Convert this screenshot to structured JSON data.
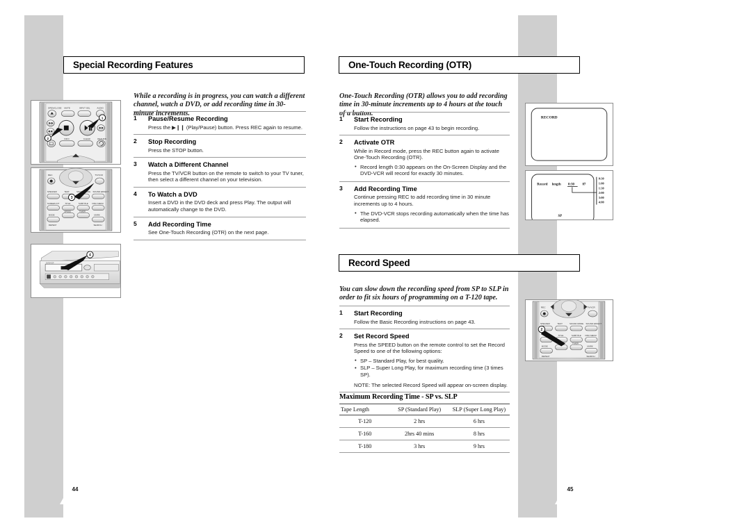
{
  "document": {
    "left_page_number": "44",
    "right_page_number": "45"
  },
  "sections": {
    "special_recording": {
      "title": "Special Recording Features",
      "intro": "While a recording is in progress, you can watch a different channel, watch a DVD, or add recording time in 30-minute increments.",
      "steps": [
        {
          "num": "1",
          "head": "Pause/Resume Recording",
          "text": "Press the ▶❙❙ (Play/Pause) button. Press REC again to resume."
        },
        {
          "num": "2",
          "head": "Stop Recording",
          "text": "Press the STOP button."
        },
        {
          "num": "3",
          "head": "Watch a Different Channel",
          "text": "Press the TV/VCR button on the remote to switch to your TV tuner, then select a different channel on your television."
        },
        {
          "num": "4",
          "head": "To Watch a DVD",
          "text": "Insert a DVD in the DVD deck and press Play. The output will automatically change to the DVD."
        },
        {
          "num": "5",
          "head": "Add Recording Time",
          "text": "See One-Touch Recording (OTR) on the next page."
        }
      ]
    },
    "one_touch_recording": {
      "title": "One-Touch Recording (OTR)",
      "intro": "One-Touch Recording (OTR) allows you to add recording time in 30-minute increments up to 4 hours at the touch of a button.",
      "steps": [
        {
          "num": "1",
          "head": "Start Recording",
          "text": "Follow the instructions on page 43 to begin recording."
        },
        {
          "num": "2",
          "head": "Activate OTR",
          "text": "While in Record mode, press the REC button again to activate One-Touch Recording (OTR).",
          "bullets": [
            "Record length 0:30 appears on the On-Screen Display and the DVD-VCR will record for exactly 30 minutes."
          ]
        },
        {
          "num": "3",
          "head": "Add Recording Time",
          "text": "Continue pressing REC to add recording time in 30 minute increments up to 4 hours.",
          "bullets": [
            "The DVD-VCR stops recording automatically when the time has elapsed."
          ]
        }
      ]
    },
    "record_speed": {
      "title": "Record Speed",
      "intro": "You can slow down the recording speed from SP to SLP in order to fit six hours of programming on a T-120 tape.",
      "steps": [
        {
          "num": "1",
          "head": "Start Recording",
          "text": "Follow the Basic Recording instructions on page 43."
        },
        {
          "num": "2",
          "head": "Set Record Speed",
          "text": "Press the SPEED button on the remote control to set the Record Speed to one of the following options:",
          "bullets": [
            "SP – Standard Play, for best quality.",
            "SLP – Super Long Play, for maximum recording time (3 times SP)."
          ],
          "note": "NOTE: The selected Record Speed will appear on-screen display."
        }
      ]
    }
  },
  "recording_time_table": {
    "title": "Maximum Recording Time - SP vs. SLP",
    "columns": [
      "Tape Length",
      "SP (Standard Play)",
      "SLP (Super Long Play)"
    ],
    "rows": [
      [
        "T-120",
        "2 hrs",
        "6 hrs"
      ],
      [
        "T-160",
        "2hrs 40 mins",
        "8 hrs"
      ],
      [
        "T-180",
        "3 hrs",
        "9 hrs"
      ]
    ]
  },
  "illustrations": {
    "remote_transport": {
      "name": "remote-transport-buttons",
      "labels": [
        "OPEN/CLOSE",
        "MUTE",
        "INPUT SEL",
        "AUDIO",
        "INFO",
        "CLEAR",
        "RETURN"
      ],
      "callouts": [
        "1",
        "2"
      ]
    },
    "remote_functions": {
      "name": "remote-function-buttons",
      "labels": [
        "REC",
        "TV/VCR",
        "SPEAKER",
        "TEST",
        "SOUND MODE",
        "SOUND EFFECT",
        "SCREEN FIT",
        "TITLE",
        "SUBTITLE",
        "DISC MENU",
        "MODE",
        "SPEED",
        "TIMER",
        "MARK",
        "REPEAT",
        "SEARCH"
      ],
      "callouts": [
        "3"
      ]
    },
    "deck_front_panel": {
      "name": "dvd-vcr-front-panel",
      "callouts": [
        "4"
      ]
    },
    "osd_record": {
      "name": "osd-record-screen",
      "text": "RECORD"
    },
    "osd_record_length": {
      "name": "osd-record-length-screen",
      "label": "Record  length",
      "value": "0:30",
      "channel": "07",
      "time_options": [
        "0:30",
        "1:00",
        "1:30",
        "2:00",
        "3:00",
        "4:00"
      ],
      "speed": "SP"
    },
    "remote_speed": {
      "name": "remote-speed-button",
      "labels": [
        "REC",
        "TV/VCR",
        "SPEAKER",
        "TEST",
        "SOUND MODE",
        "SOUND EFFECT",
        "TITLE",
        "SUBTITLE",
        "DISC MENU",
        "MODE",
        "SPEED",
        "TIMER",
        "MARK",
        "REPEAT",
        "SEARCH"
      ],
      "callouts": [
        "2"
      ]
    }
  }
}
